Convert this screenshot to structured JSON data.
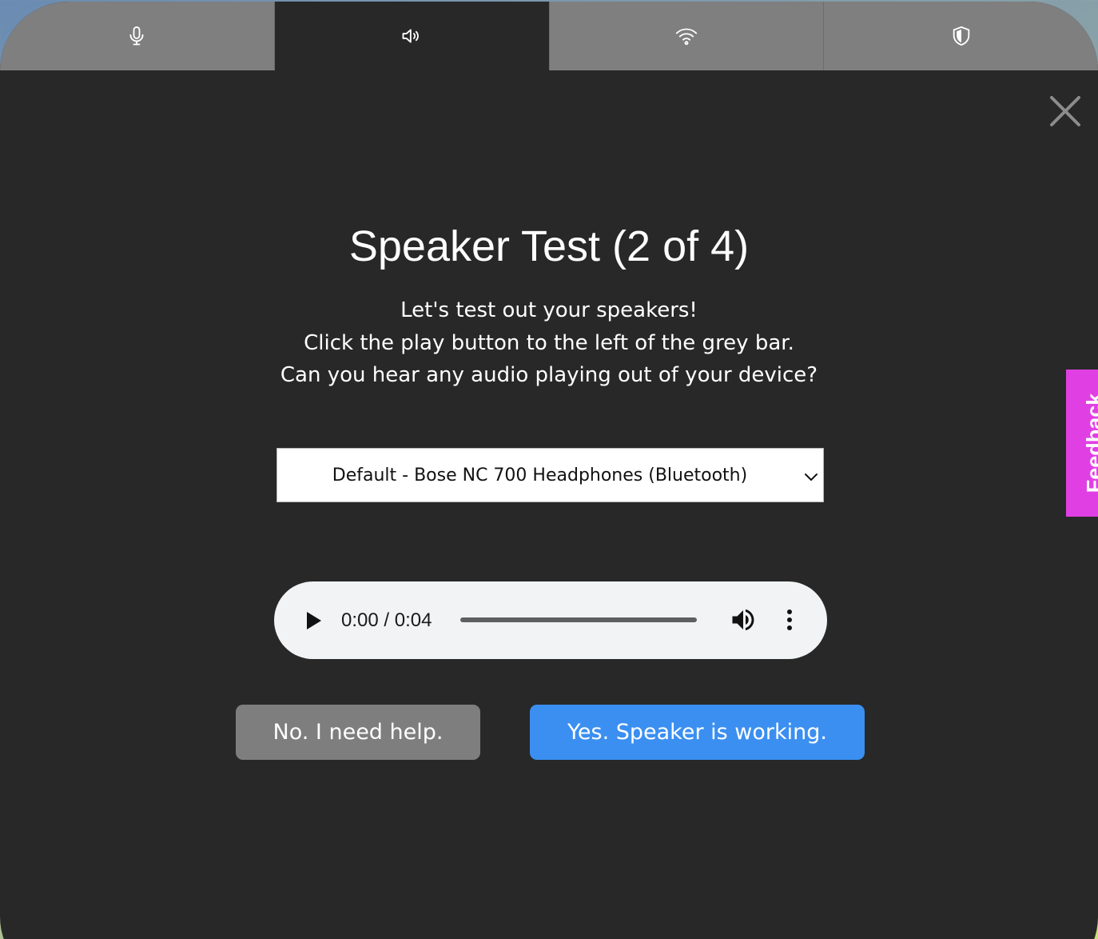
{
  "tabs": [
    {
      "icon": "microphone-icon",
      "active": false
    },
    {
      "icon": "speaker-icon",
      "active": true
    },
    {
      "icon": "wifi-icon",
      "active": false
    },
    {
      "icon": "shield-icon",
      "active": false
    }
  ],
  "title": "Speaker Test (2 of 4)",
  "instructions": {
    "line1": "Let's test out your speakers!",
    "line2": "Click the play button to the left of the grey bar.",
    "line3": "Can you hear any audio playing out of your device?"
  },
  "output_device": {
    "selected": "Default - Bose NC 700 Headphones (Bluetooth)"
  },
  "audio_player": {
    "time_display": "0:00 / 0:04",
    "progress": 0
  },
  "buttons": {
    "no_label": "No. I need help.",
    "yes_label": "Yes. Speaker is working."
  },
  "feedback": {
    "label": "Feedback"
  },
  "colors": {
    "panel_background": "#282828",
    "tab_inactive": "#7f7f7f",
    "primary_button": "#3b8ff0",
    "secondary_button": "#7e7e7e",
    "feedback_tab": "#e040e3"
  }
}
